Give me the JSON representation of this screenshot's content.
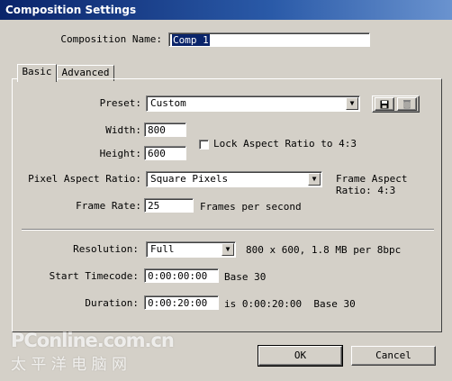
{
  "window": {
    "title": "Composition Settings"
  },
  "comp_name": {
    "label": "Composition Name:",
    "value": "Comp 1"
  },
  "tabs": [
    {
      "label": "Basic",
      "active": true
    },
    {
      "label": "Advanced",
      "active": false
    }
  ],
  "preset": {
    "label": "Preset:",
    "value": "Custom",
    "save_icon": "floppy-disk-icon",
    "delete_icon": "trash-icon"
  },
  "width": {
    "label": "Width:",
    "value": "800"
  },
  "height": {
    "label": "Height:",
    "value": "600"
  },
  "lock_aspect": {
    "label": "Lock Aspect Ratio to 4:3",
    "checked": false
  },
  "pixel_aspect": {
    "label": "Pixel Aspect Ratio:",
    "value": "Square Pixels"
  },
  "frame_aspect": {
    "line1": "Frame Aspect",
    "line2": "Ratio: 4:3"
  },
  "frame_rate": {
    "label": "Frame Rate:",
    "value": "25",
    "unit": "Frames per second"
  },
  "resolution": {
    "label": "Resolution:",
    "value": "Full",
    "info": "800 x 600, 1.8 MB per 8bpc"
  },
  "start_timecode": {
    "label": "Start Timecode:",
    "value": "0:00:00:00",
    "base": "Base 30"
  },
  "duration": {
    "label": "Duration:",
    "value": "0:00:20:00",
    "info": "is 0:00:20:00  Base 30"
  },
  "buttons": {
    "ok": "OK",
    "cancel": "Cancel"
  },
  "watermark": {
    "line1": "PConline.com.cn",
    "line2": "太 平 洋 电 脑 网"
  },
  "colors": {
    "face": "#d4d0c8",
    "title_start": "#0a246a",
    "title_end": "#6a93cf",
    "selection": "#0a246a"
  }
}
